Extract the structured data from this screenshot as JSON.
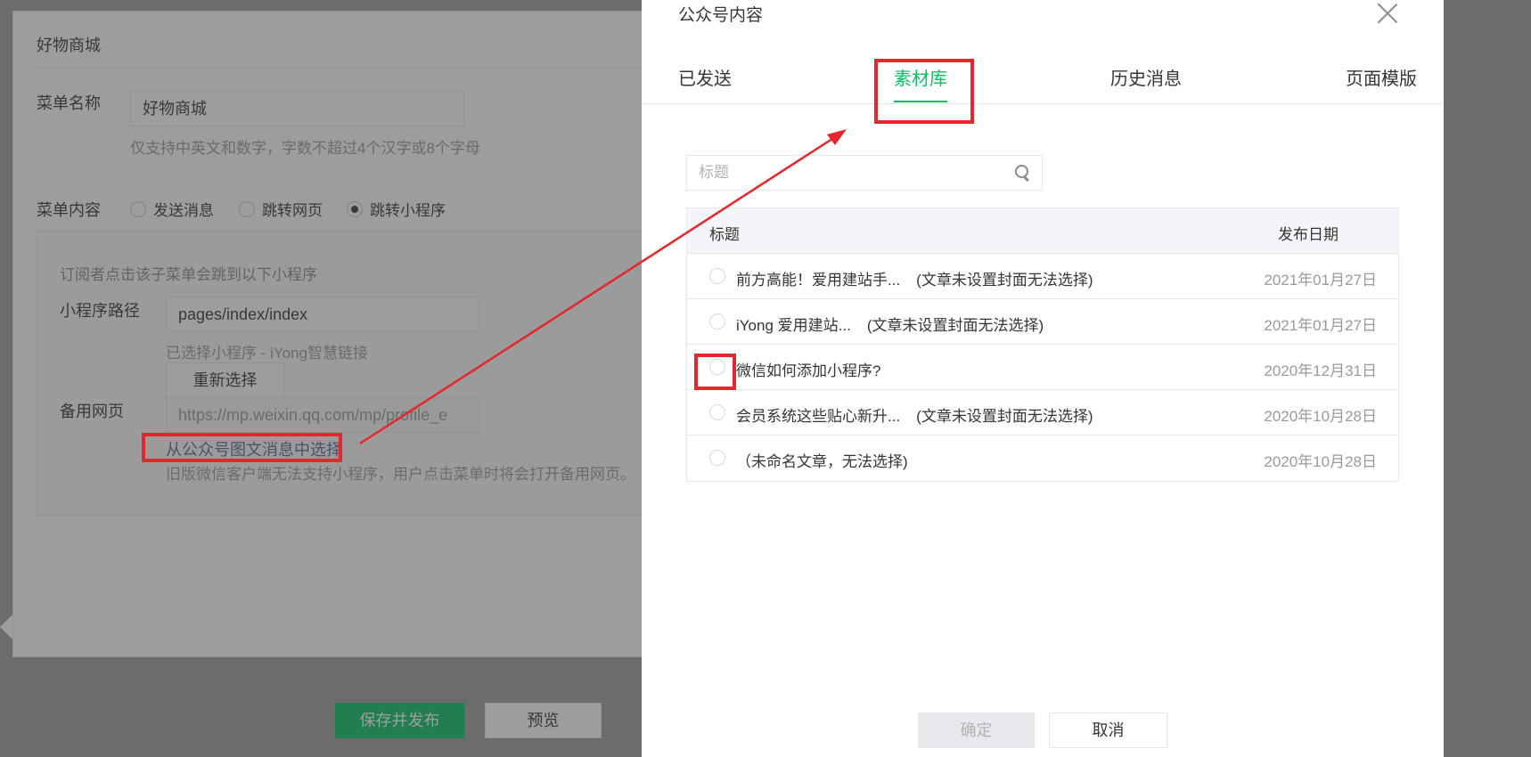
{
  "editor": {
    "menu_header": "好物商城",
    "menu_name_label": "菜单名称",
    "menu_name_value": "好物商城",
    "menu_name_tip": "仅支持中英文和数字，字数不超过4个汉字或8个字母",
    "menu_content_label": "菜单内容",
    "radio_send_message": "发送消息",
    "radio_jump_webpage": "跳转网页",
    "radio_jump_miniprogram": "跳转小程序",
    "sub_tip": "订阅者点击该子菜单会跳到以下小程序",
    "path_label": "小程序路径",
    "path_value": "pages/index/index",
    "selected_miniprogram": "已选择小程序 - iYong智慧链接",
    "reselect_button": "重新选择",
    "backup_label": "备用网页",
    "backup_value": "https://mp.weixin.qq.com/mp/profile_e",
    "choose_from_article_link": "从公众号图文消息中选择",
    "backup_tip": "旧版微信客户端无法支持小程序，用户点击菜单时将会打开备用网页。",
    "save_publish_button": "保存并发布",
    "preview_button": "预览"
  },
  "dialog": {
    "title": "公众号内容",
    "tabs": [
      {
        "label": "已发送",
        "active": false
      },
      {
        "label": "素材库",
        "active": true
      },
      {
        "label": "历史消息",
        "active": false
      },
      {
        "label": "页面模版",
        "active": false
      }
    ],
    "search_placeholder": "标题",
    "table": {
      "col_title": "标题",
      "col_date": "发布日期",
      "rows": [
        {
          "title": "前方高能！爱用建站手...",
          "note": "(文章未设置封面无法选择)",
          "date": "2021年01月27日"
        },
        {
          "title": "iYong 爱用建站...",
          "note": "(文章未设置封面无法选择)",
          "date": "2021年01月27日"
        },
        {
          "title": "微信如何添加小程序?",
          "note": "",
          "date": "2020年12月31日"
        },
        {
          "title": "会员系统这些贴心新升...",
          "note": "(文章未设置封面无法选择)",
          "date": "2020年10月28日"
        },
        {
          "title": "（未命名文章，无法选择)",
          "note": "",
          "date": "2020年10月28日"
        }
      ]
    },
    "confirm_button": "确定",
    "cancel_button": "取消"
  },
  "colors": {
    "accent_green": "#07c160",
    "annotation_red": "#e5262c",
    "link_blue": "#576b95"
  }
}
